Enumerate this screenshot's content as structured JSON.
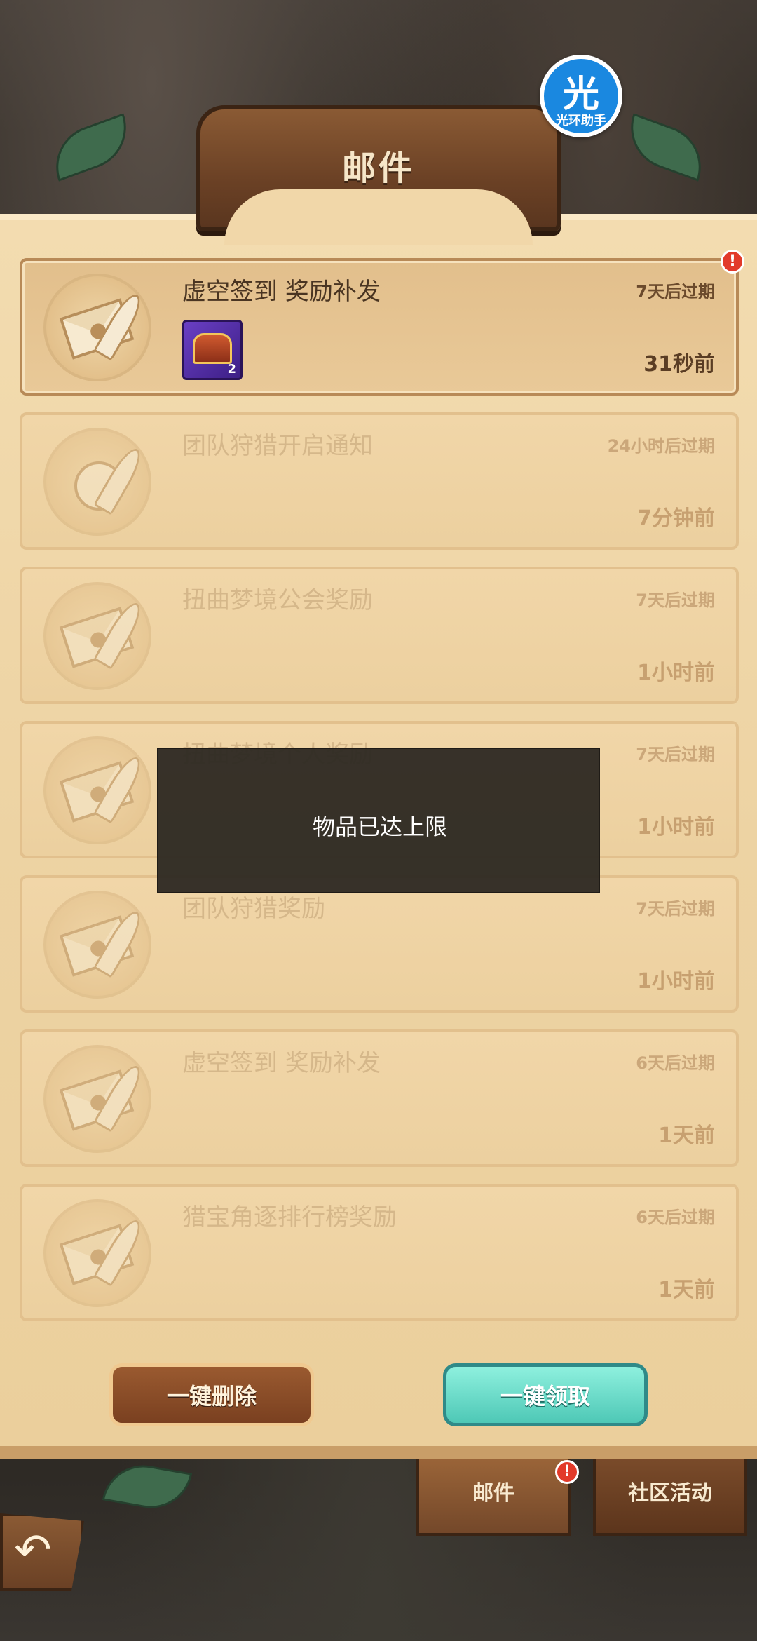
{
  "header": {
    "title": "邮件"
  },
  "helper": {
    "glyph": "光",
    "caption": "光环助手"
  },
  "mails": [
    {
      "title": "虚空签到 奖励补发",
      "expire": "7天后过期",
      "time": "31秒前",
      "unread": true,
      "icon": "envelope-icon",
      "attachment_count": "2"
    },
    {
      "title": "团队狩猎开启通知",
      "expire": "24小时后过期",
      "time": "7分钟前",
      "unread": false,
      "icon": "bell-icon"
    },
    {
      "title": "扭曲梦境公会奖励",
      "expire": "7天后过期",
      "time": "1小时前",
      "unread": false,
      "icon": "envelope-icon"
    },
    {
      "title": "扭曲梦境个人奖励",
      "expire": "7天后过期",
      "time": "1小时前",
      "unread": false,
      "icon": "envelope-icon"
    },
    {
      "title": "团队狩猎奖励",
      "expire": "7天后过期",
      "time": "1小时前",
      "unread": false,
      "icon": "envelope-icon"
    },
    {
      "title": "虚空签到 奖励补发",
      "expire": "6天后过期",
      "time": "1天前",
      "unread": false,
      "icon": "envelope-icon"
    },
    {
      "title": "猎宝角逐排行榜奖励",
      "expire": "6天后过期",
      "time": "1天前",
      "unread": false,
      "icon": "envelope-icon"
    }
  ],
  "toast": {
    "message": "物品已达上限"
  },
  "buttons": {
    "delete_all": "一键删除",
    "claim_all": "一键领取"
  },
  "tabs": [
    {
      "label": "邮件",
      "active": true,
      "badge": "!"
    },
    {
      "label": "社区活动",
      "active": false
    }
  ],
  "badges": {
    "mail_alert": "!"
  },
  "colors": {
    "parchment": "#edd3a3",
    "wood": "#6b4125",
    "claim_teal": "#4ec8b6",
    "alert_red": "#e23a2a"
  }
}
